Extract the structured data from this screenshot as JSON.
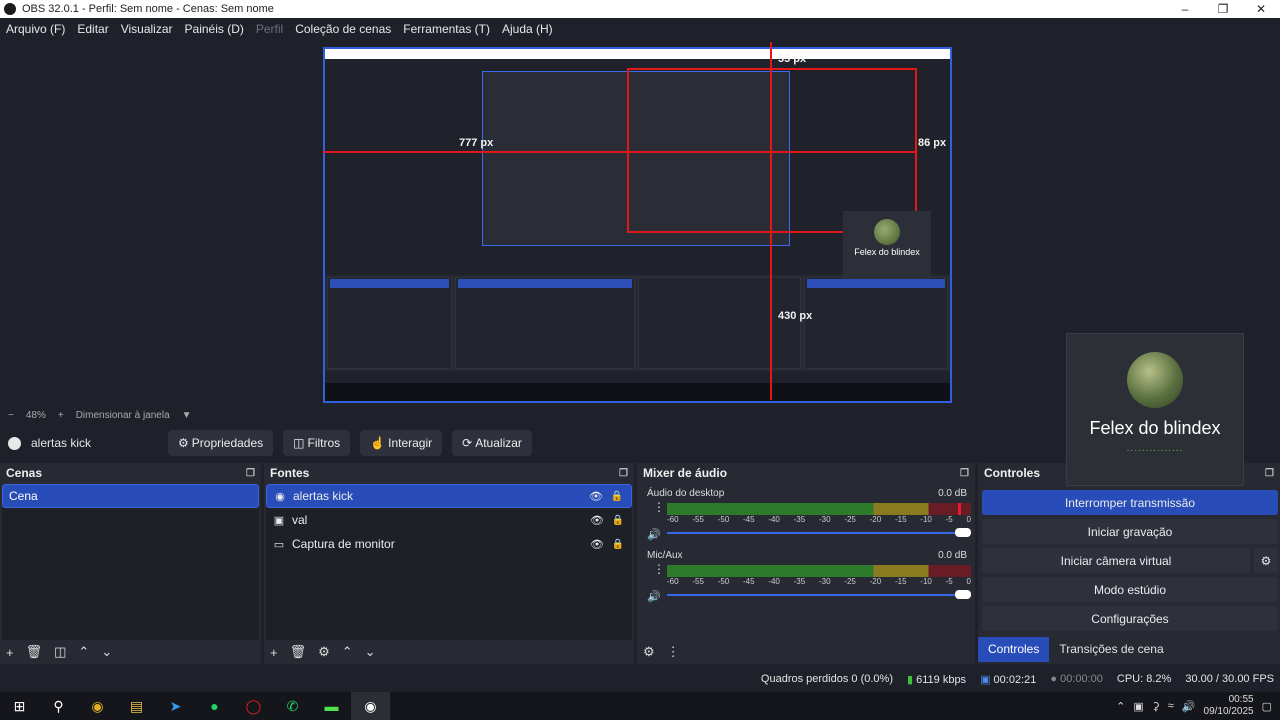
{
  "window": {
    "title": "OBS 32.0.1 - Perfil: Sem nome - Cenas: Sem nome"
  },
  "menu": [
    "Arquivo (F)",
    "Editar",
    "Visualizar",
    "Painéis (D)",
    "Perfil",
    "Coleção de cenas",
    "Ferramentas (T)",
    "Ajuda (H)"
  ],
  "preview": {
    "labels": {
      "top": "55 px",
      "left": "777 px",
      "right": "86 px",
      "bottom": "430 px"
    },
    "mini_cam_name": "Felex do blindex"
  },
  "zoom": {
    "minus": "−",
    "value": "48%",
    "plus": "+",
    "mode": "Dimensionar à janela"
  },
  "source_toolbar": {
    "current": "alertas kick",
    "properties": "Propriedades",
    "filters": "Filtros",
    "interact": "Interagir",
    "refresh": "Atualizar"
  },
  "scenes": {
    "title": "Cenas",
    "items": [
      "Cena"
    ]
  },
  "sources": {
    "title": "Fontes",
    "items": [
      {
        "name": "alertas kick",
        "icon": "browser-icon"
      },
      {
        "name": "val",
        "icon": "window-icon"
      },
      {
        "name": "Captura de monitor",
        "icon": "monitor-icon"
      }
    ]
  },
  "mixer": {
    "title": "Mixer de áudio",
    "channels": [
      {
        "name": "Áudio do desktop",
        "db": "0.0 dB"
      },
      {
        "name": "Mic/Aux",
        "db": "0.0 dB"
      }
    ],
    "scale": [
      "-60",
      "-55",
      "-50",
      "-45",
      "-40",
      "-35",
      "-30",
      "-25",
      "-20",
      "-15",
      "-10",
      "-5",
      "0"
    ]
  },
  "controls": {
    "title": "Controles",
    "stop_stream": "Interromper transmissão",
    "start_record": "Iniciar gravação",
    "start_vcam": "Iniciar câmera virtual",
    "studio_mode": "Modo estúdio",
    "settings": "Configurações",
    "tab_controls": "Controles",
    "tab_transitions": "Transições de cena"
  },
  "camera": {
    "name": "Felex do blindex",
    "dots": "..............."
  },
  "status": {
    "dropped": "Quadros perdidos 0 (0.0%)",
    "bitrate": "6119 kbps",
    "stream_time": "00:02:21",
    "record_time": "00:00:00",
    "cpu": "CPU: 8.2%",
    "fps": "30.00 / 30.00 FPS"
  },
  "clock": {
    "time": "00:55",
    "date": "09/10/2025"
  },
  "colors": {
    "accent": "#284cb8",
    "bg": "#1f212a",
    "dock": "#272a33",
    "alert": "#e01818"
  }
}
